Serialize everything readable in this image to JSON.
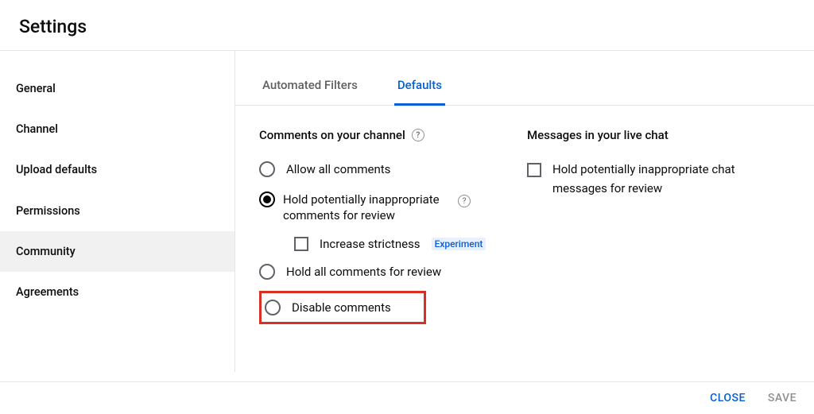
{
  "header": {
    "title": "Settings"
  },
  "sidebar": {
    "items": [
      {
        "label": "General"
      },
      {
        "label": "Channel"
      },
      {
        "label": "Upload defaults"
      },
      {
        "label": "Permissions"
      },
      {
        "label": "Community"
      },
      {
        "label": "Agreements"
      }
    ],
    "selected": 4
  },
  "tabs": {
    "items": [
      {
        "label": "Automated Filters"
      },
      {
        "label": "Defaults"
      }
    ],
    "active": 1
  },
  "comments": {
    "heading": "Comments on your channel",
    "options": [
      {
        "label": "Allow all comments",
        "checked": false
      },
      {
        "label": "Hold potentially inappropriate comments for review",
        "checked": true
      },
      {
        "label": "Hold all comments for review",
        "checked": false
      },
      {
        "label": "Disable comments",
        "checked": false
      }
    ],
    "sub": {
      "label": "Increase strictness",
      "badge": "Experiment",
      "checked": false
    }
  },
  "chat": {
    "heading": "Messages in your live chat",
    "option": {
      "label": "Hold potentially inappropriate chat messages for review",
      "checked": false
    }
  },
  "footer": {
    "close": "CLOSE",
    "save": "SAVE"
  }
}
